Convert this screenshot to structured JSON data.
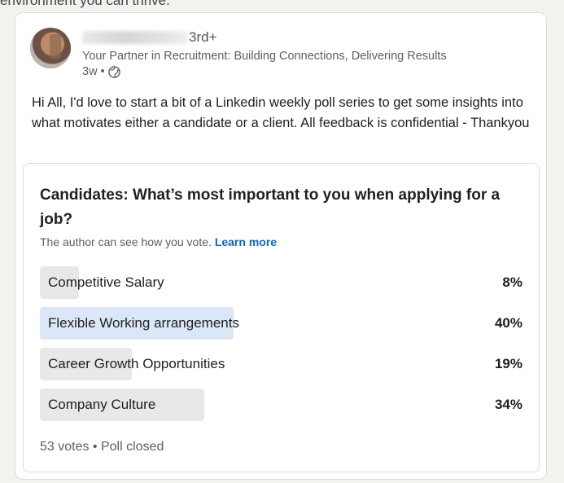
{
  "cutoff_text": "environment you can thrive.",
  "post": {
    "author_degree": "3rd+",
    "author_headline": "Your Partner in Recruitment: Building Connections, Delivering Results",
    "time_ago": "3w",
    "separator": "•",
    "visibility_icon": "globe-icon",
    "body": "Hi All, I'd love to start a bit of a Linkedin weekly poll series to get some insights into what motivates either a candidate or a client. All feedback is confidential - Thankyou"
  },
  "poll": {
    "question": "Candidates: What’s most important to you when applying for a job?",
    "visibility_note": "The author can see how you vote.",
    "learn_more": "Learn more",
    "options": [
      {
        "label": "Competitive Salary",
        "percent_text": "8%",
        "percent": 8,
        "selected": false
      },
      {
        "label": "Flexible Working arrangements",
        "percent_text": "40%",
        "percent": 40,
        "selected": true
      },
      {
        "label": "Career Growth Opportunities",
        "percent_text": "19%",
        "percent": 19,
        "selected": false
      },
      {
        "label": "Company Culture",
        "percent_text": "34%",
        "percent": 34,
        "selected": false
      }
    ],
    "votes_text": "53 votes • Poll closed"
  },
  "colors": {
    "link": "#0a66c2",
    "selected_bar": "#dbe7f7",
    "bar": "#e8e8e8"
  }
}
